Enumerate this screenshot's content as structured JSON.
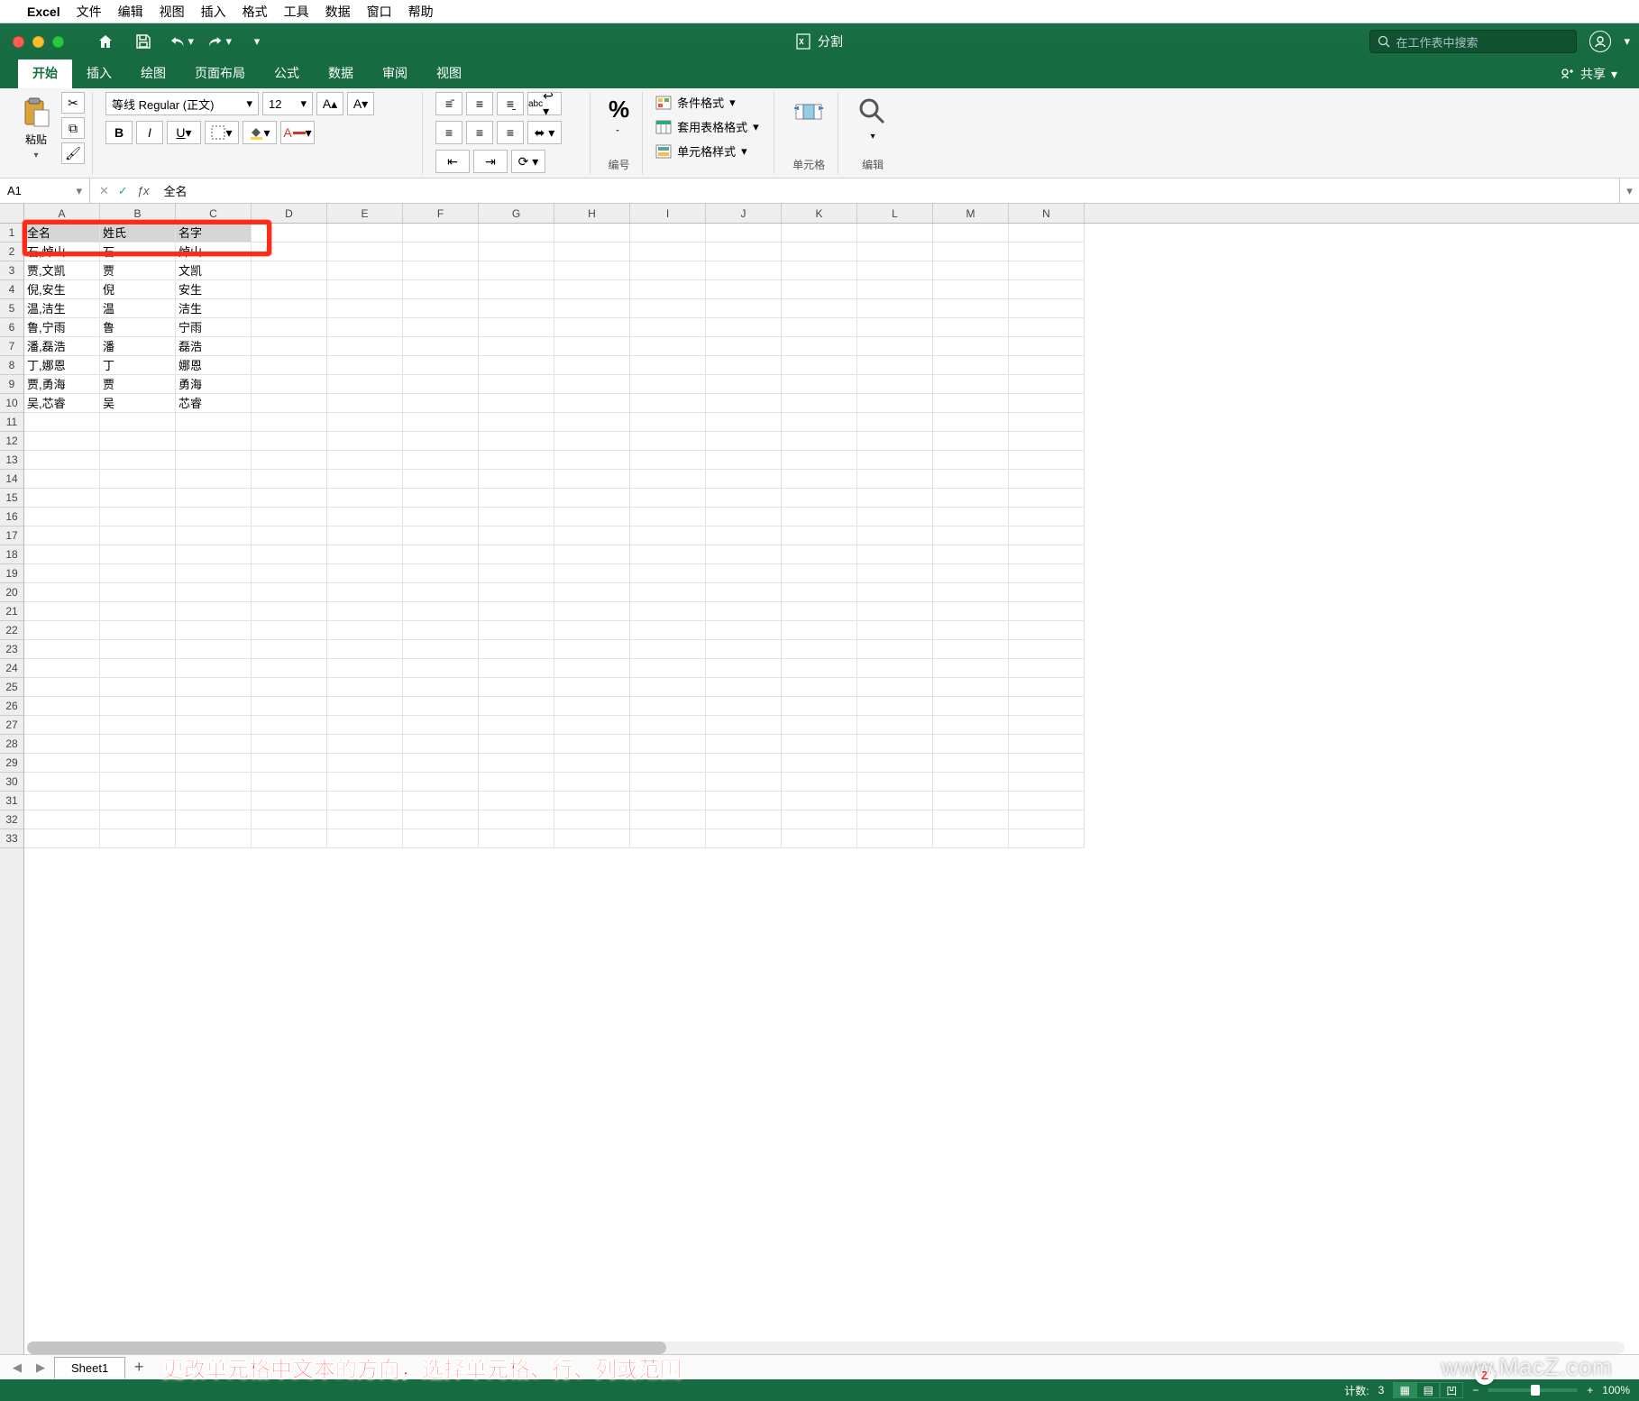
{
  "mac_menu": [
    "Excel",
    "文件",
    "编辑",
    "视图",
    "插入",
    "格式",
    "工具",
    "数据",
    "窗口",
    "帮助"
  ],
  "titlebar": {
    "doc_name": "分割",
    "search_placeholder": "在工作表中搜索"
  },
  "ribbon_tabs": [
    "开始",
    "插入",
    "绘图",
    "页面布局",
    "公式",
    "数据",
    "审阅",
    "视图"
  ],
  "share_label": "共享",
  "ribbon": {
    "clipboard": {
      "paste": "粘贴"
    },
    "font": {
      "name": "等线 Regular (正文)",
      "size": "12",
      "bold": "B",
      "italic": "I",
      "underline": "U"
    },
    "wrap": "abc",
    "number_label": "编号",
    "styles": {
      "cond": "条件格式",
      "table": "套用表格格式",
      "cell": "单元格样式"
    },
    "cells_label": "单元格",
    "editing_label": "编辑"
  },
  "formula_bar": {
    "name_box": "A1",
    "value": "全名"
  },
  "columns": [
    "A",
    "B",
    "C",
    "D",
    "E",
    "F",
    "G",
    "H",
    "I",
    "J",
    "K",
    "L",
    "M",
    "N"
  ],
  "row_count": 33,
  "data_rows": [
    [
      "全名",
      "姓氏",
      "名字"
    ],
    [
      "石,焯山",
      "石",
      "焯山"
    ],
    [
      "贾,文凯",
      "贾",
      "文凯"
    ],
    [
      "倪,安生",
      "倪",
      "安生"
    ],
    [
      "温,洁生",
      "温",
      "洁生"
    ],
    [
      "鲁,宁雨",
      "鲁",
      "宁雨"
    ],
    [
      "潘,磊浩",
      "潘",
      "磊浩"
    ],
    [
      "丁,娜恩",
      "丁",
      "娜恩"
    ],
    [
      "贾,勇海",
      "贾",
      "勇海"
    ],
    [
      "吴,芯睿",
      "吴",
      "芯睿"
    ]
  ],
  "sheet_tabs": {
    "active": "Sheet1"
  },
  "caption": "更改单元格中文本的方向，选择单元格、行、列或范围",
  "status": {
    "count_label": "计数:",
    "count": "3",
    "zoom": "100%"
  },
  "watermark": "www.MacZ.com",
  "z_badge": "Z"
}
